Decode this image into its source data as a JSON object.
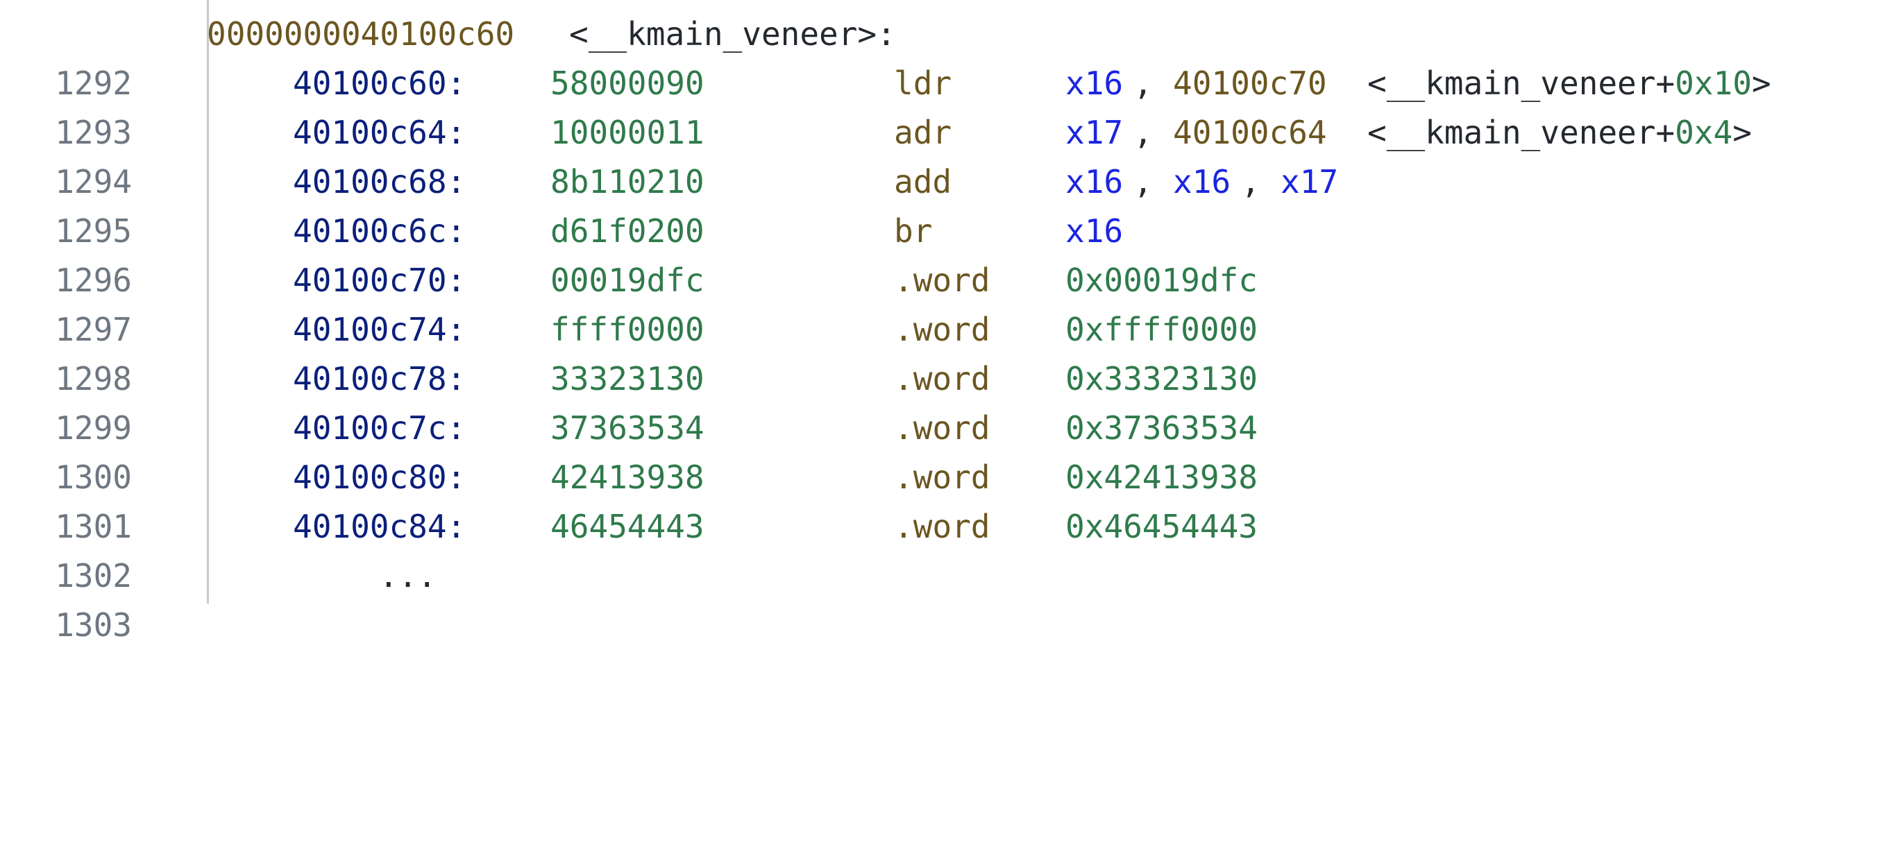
{
  "editor": {
    "header": {
      "line_number": "1292",
      "address": "0000000040100c60",
      "label": "<__kmain_veneer>:"
    },
    "rows": [
      {
        "line_number": "1293",
        "address": "40100c60:",
        "bytes": "58000090",
        "mnemonic": "ldr",
        "reg1": "x16",
        "sep1": ",",
        "target": "40100c70",
        "symbol_prefix": "<__kmain_veneer+",
        "symbol_offset": "0x10",
        "symbol_suffix": ">"
      },
      {
        "line_number": "1294",
        "address": "40100c64:",
        "bytes": "10000011",
        "mnemonic": "adr",
        "reg1": "x17",
        "sep1": ",",
        "target": "40100c64",
        "symbol_prefix": "<__kmain_veneer+",
        "symbol_offset": "0x4",
        "symbol_suffix": ">"
      },
      {
        "line_number": "1295",
        "address": "40100c68:",
        "bytes": "8b110210",
        "mnemonic": "add",
        "reg1": "x16",
        "sep1": ",",
        "reg2": "x16",
        "sep2": ",",
        "reg3": "x17"
      },
      {
        "line_number": "1296",
        "address": "40100c6c:",
        "bytes": "d61f0200",
        "mnemonic": "br",
        "reg1": "x16"
      },
      {
        "line_number": "1297",
        "address": "40100c70:",
        "bytes": "00019dfc",
        "mnemonic": ".word",
        "value": "0x00019dfc"
      },
      {
        "line_number": "1298",
        "address": "40100c74:",
        "bytes": "ffff0000",
        "mnemonic": ".word",
        "value": "0xffff0000"
      },
      {
        "line_number": "1299",
        "address": "40100c78:",
        "bytes": "33323130",
        "mnemonic": ".word",
        "value": "0x33323130"
      },
      {
        "line_number": "1300",
        "address": "40100c7c:",
        "bytes": "37363534",
        "mnemonic": ".word",
        "value": "0x37363534"
      },
      {
        "line_number": "1301",
        "address": "40100c80:",
        "bytes": "42413938",
        "mnemonic": ".word",
        "value": "0x42413938"
      },
      {
        "line_number": "1302",
        "address": "40100c84:",
        "bytes": "46454443",
        "mnemonic": ".word",
        "value": "0x46454443"
      }
    ],
    "footer": {
      "line_number": "1303",
      "ellipsis": "..."
    }
  },
  "colors": {
    "line_number": "#6e7781",
    "address": "#0b1f7a",
    "bytes": "#2f7a4b",
    "mnemonic": "#6b5620",
    "register": "#1a24e0",
    "immediate": "#2f7a4b",
    "plain": "#24292f"
  }
}
